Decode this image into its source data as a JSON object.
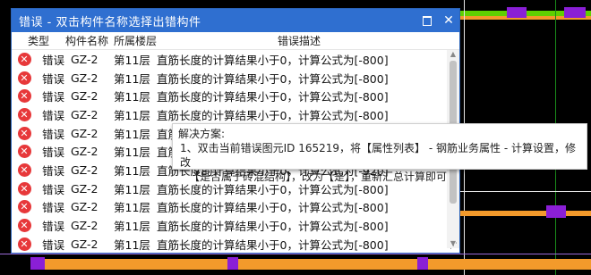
{
  "dialog": {
    "title": "错误 - 双击构件名称选择出错构件",
    "restore_icon": "restore-window-icon",
    "close_label": "✕"
  },
  "columns": {
    "type": "类型",
    "name": "构件名称",
    "floor": "所属楼层",
    "desc": "错误描述"
  },
  "rows": [
    {
      "type": "错误",
      "name": "GZ-2",
      "floor": "第11层",
      "desc": "直筋长度的计算结果小于0，计算公式为[-800]"
    },
    {
      "type": "错误",
      "name": "GZ-2",
      "floor": "第11层",
      "desc": "直筋长度的计算结果小于0，计算公式为[-800]"
    },
    {
      "type": "错误",
      "name": "GZ-2",
      "floor": "第11层",
      "desc": "直筋长度的计算结果小于0，计算公式为[-800]"
    },
    {
      "type": "错误",
      "name": "GZ-2",
      "floor": "第11层",
      "desc": "直筋长度的计算结果小于0，计算公式为[-800]"
    },
    {
      "type": "错误",
      "name": "GZ-2",
      "floor": "第11层",
      "desc": "直筋长度的计算结果小于0，计算公式为[-800]"
    },
    {
      "type": "错误",
      "name": "GZ-2",
      "floor": "第11层",
      "desc": "直筋长度的计算结果小于0，计算公式为[-800]"
    },
    {
      "type": "错误",
      "name": "GZ-2",
      "floor": "第11层",
      "desc": "直筋长度的计算结果小于0，计算公式为[-920]"
    },
    {
      "type": "错误",
      "name": "GZ-2",
      "floor": "第11层",
      "desc": "直筋长度的计算结果小于0，计算公式为[-800]"
    },
    {
      "type": "错误",
      "name": "GZ-2",
      "floor": "第11层",
      "desc": "直筋长度的计算结果小于0，计算公式为[-800]"
    },
    {
      "type": "错误",
      "name": "GZ-2",
      "floor": "第11层",
      "desc": "直筋长度的计算结果小于0，计算公式为[-800]"
    },
    {
      "type": "错误",
      "name": "GZ-2",
      "floor": "第11层",
      "desc": "直筋长度的计算结果小于0，计算公式为[-800]"
    }
  ],
  "tooltip": {
    "heading": "解决方案:",
    "line1": "1、双击当前错误图元ID 165219，将【属性列表】 - 钢筋业务属性 - 计算设置，修改",
    "line2": "【是否属于砖混结构】，改为【是】，重新汇总计算即可"
  },
  "colors": {
    "titlebar": "#2f6fd0",
    "error_icon": "#e7383a",
    "cad_orange": "#f39a2b",
    "cad_purple": "#8a1fd6",
    "cad_green": "#5fd000"
  }
}
